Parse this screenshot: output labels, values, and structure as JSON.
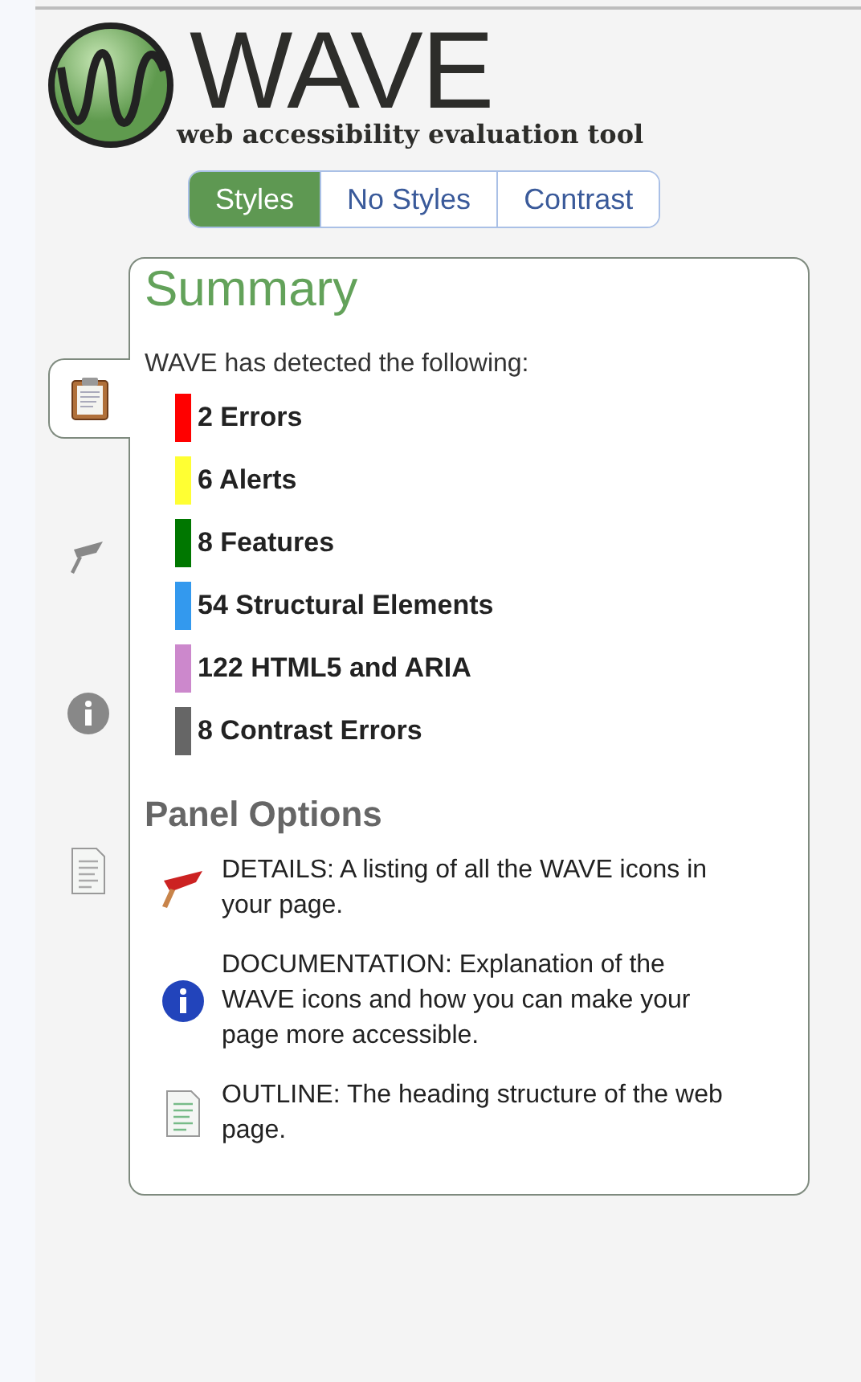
{
  "logo": {
    "name": "WAVE",
    "tagline": "web accessibility evaluation tool"
  },
  "view_modes": [
    {
      "label": "Styles",
      "selected": true
    },
    {
      "label": "No Styles",
      "selected": false
    },
    {
      "label": "Contrast",
      "selected": false
    }
  ],
  "side_tabs": [
    {
      "kind": "summary",
      "selected": true
    },
    {
      "kind": "details",
      "selected": false
    },
    {
      "kind": "documentation",
      "selected": false
    },
    {
      "kind": "outline",
      "selected": false
    }
  ],
  "summary": {
    "title": "Summary",
    "intro": "WAVE has detected the following:",
    "counts": [
      {
        "text": "2 Errors",
        "color": "#ff0000"
      },
      {
        "text": "6 Alerts",
        "color": "#ffff33"
      },
      {
        "text": "8 Features",
        "color": "#007700"
      },
      {
        "text": "54 Structural Elements",
        "color": "#3399ee"
      },
      {
        "text": "122 HTML5 and ARIA",
        "color": "#cc88cc"
      },
      {
        "text": "8 Contrast Errors",
        "color": "#666666"
      }
    ]
  },
  "panel_options": {
    "title": "Panel Options",
    "items": [
      {
        "kind": "details",
        "text": "DETAILS: A listing of all the WAVE icons in your page."
      },
      {
        "kind": "documentation",
        "text": "DOCUMENTATION: Explanation of the WAVE icons and how you can make your page more accessible."
      },
      {
        "kind": "outline",
        "text": "OUTLINE: The heading structure of the web page."
      }
    ]
  }
}
